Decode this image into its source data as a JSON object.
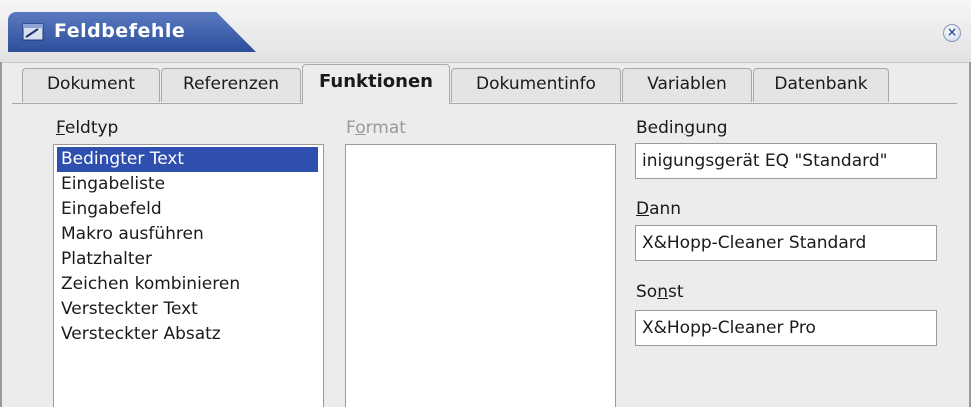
{
  "window": {
    "title": "Feldbefehle",
    "close_symbol": "×",
    "title_icon": "dialog-icon"
  },
  "tabs": [
    {
      "label": "Dokument"
    },
    {
      "label": "Referenzen"
    },
    {
      "label": "Funktionen",
      "active": true
    },
    {
      "label": "Dokumentinfo"
    },
    {
      "label": "Variablen"
    },
    {
      "label": "Datenbank"
    }
  ],
  "feldtyp": {
    "label_mnemonic": "F",
    "label_rest": "eldtyp",
    "items": [
      "Bedingter Text",
      "Eingabeliste",
      "Eingabefeld",
      "Makro ausführen",
      "Platzhalter",
      "Zeichen kombinieren",
      "Versteckter Text",
      "Versteckter Absatz"
    ],
    "selected_index": 0
  },
  "format": {
    "label_pre": "F",
    "label_mnemonic": "o",
    "label_rest": "rmat"
  },
  "bedingung": {
    "label_pre": "Bedin",
    "label_mnemonic": "g",
    "label_rest": "ung",
    "value": "inigungsgerät EQ \"Standard\""
  },
  "dann": {
    "label_mnemonic": "D",
    "label_rest": "ann",
    "value": "X&Hopp-Cleaner Standard"
  },
  "sonst": {
    "label_pre": "So",
    "label_mnemonic": "n",
    "label_rest": "st",
    "value": "X&Hopp-Cleaner Pro"
  },
  "colors": {
    "title_bar_blue": "#2c4e9c",
    "selection_blue": "#2e4fae",
    "background": "#ececec"
  }
}
